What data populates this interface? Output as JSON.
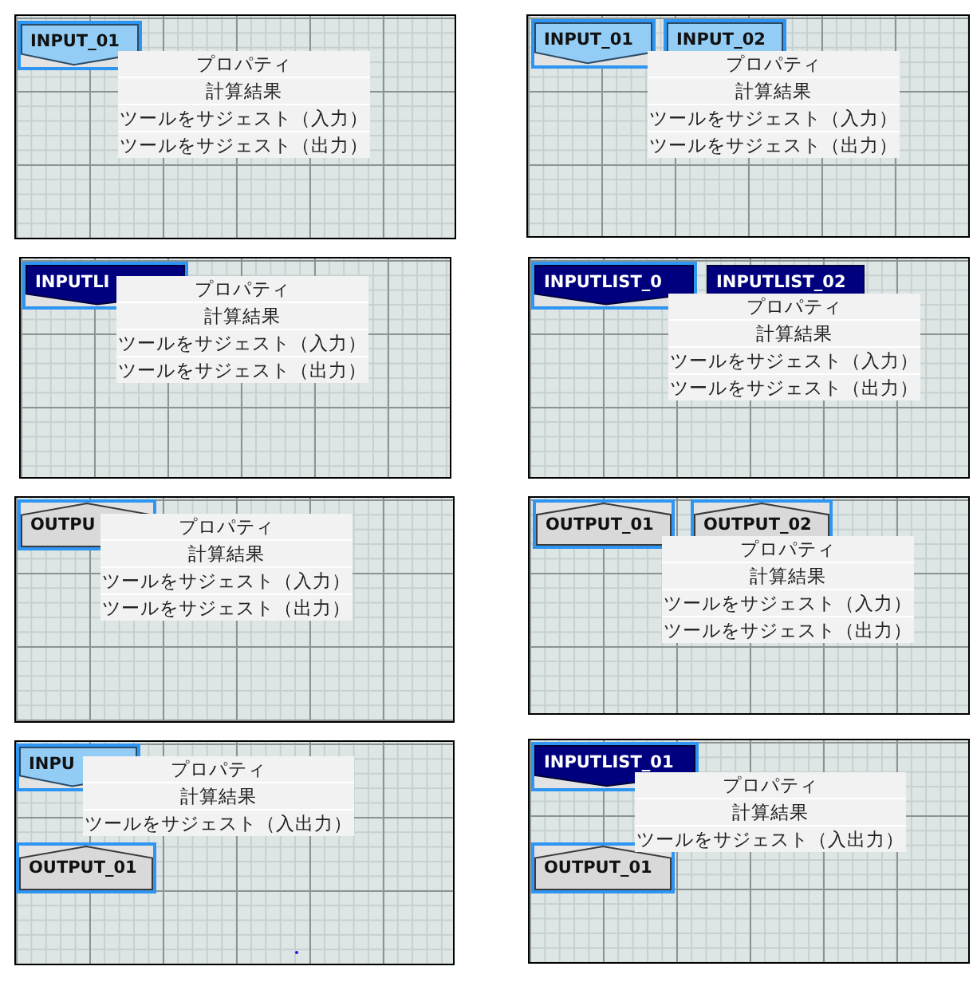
{
  "panels": [
    {
      "nodes": [
        {
          "kind": "input",
          "label": "INPUT_01",
          "selected": true
        }
      ],
      "menu": {
        "items": [
          "プロパティ",
          "計算結果",
          "ツールをサジェスト（入力）",
          "ツールをサジェスト（出力）"
        ]
      }
    },
    {
      "nodes": [
        {
          "kind": "input",
          "label": "INPUT_01",
          "selected": true
        },
        {
          "kind": "input",
          "label": "INPUT_02",
          "selected": true
        }
      ],
      "menu": {
        "items": [
          "プロパティ",
          "計算結果",
          "ツールをサジェスト（入力）",
          "ツールをサジェスト（出力）"
        ]
      }
    },
    {
      "nodes": [
        {
          "kind": "inputlist",
          "label": "INPUTLI",
          "selected": true
        }
      ],
      "menu": {
        "items": [
          "プロパティ",
          "計算結果",
          "ツールをサジェスト（入力）",
          "ツールをサジェスト（出力）"
        ]
      }
    },
    {
      "nodes": [
        {
          "kind": "inputlist",
          "label": "INPUTLIST_0",
          "selected": true
        },
        {
          "kind": "inputlist",
          "label": "INPUTLIST_02",
          "selected": false
        }
      ],
      "menu": {
        "items": [
          "プロパティ",
          "計算結果",
          "ツールをサジェスト（入力）",
          "ツールをサジェスト（出力）"
        ]
      }
    },
    {
      "nodes": [
        {
          "kind": "output",
          "label": "OUTPU",
          "selected": true
        }
      ],
      "menu": {
        "items": [
          "プロパティ",
          "計算結果",
          "ツールをサジェスト（入力）",
          "ツールをサジェスト（出力）"
        ]
      }
    },
    {
      "nodes": [
        {
          "kind": "output",
          "label": "OUTPUT_01",
          "selected": true
        },
        {
          "kind": "output",
          "label": "OUTPUT_02",
          "selected": true
        }
      ],
      "menu": {
        "items": [
          "プロパティ",
          "計算結果",
          "ツールをサジェスト（入力）",
          "ツールをサジェスト（出力）"
        ]
      }
    },
    {
      "nodes": [
        {
          "kind": "input",
          "label": "INPU",
          "selected": true
        },
        {
          "kind": "output",
          "label": "OUTPUT_01",
          "selected": true
        }
      ],
      "menu": {
        "items": [
          "プロパティ",
          "計算結果",
          "ツールをサジェスト（入出力）"
        ]
      }
    },
    {
      "nodes": [
        {
          "kind": "inputlist",
          "label": "INPUTLIST_01",
          "selected": true
        },
        {
          "kind": "output",
          "label": "OUTPUT_01",
          "selected": true
        }
      ],
      "menu": {
        "items": [
          "プロパティ",
          "計算結果",
          "ツールをサジェスト（入出力）"
        ]
      }
    }
  ]
}
